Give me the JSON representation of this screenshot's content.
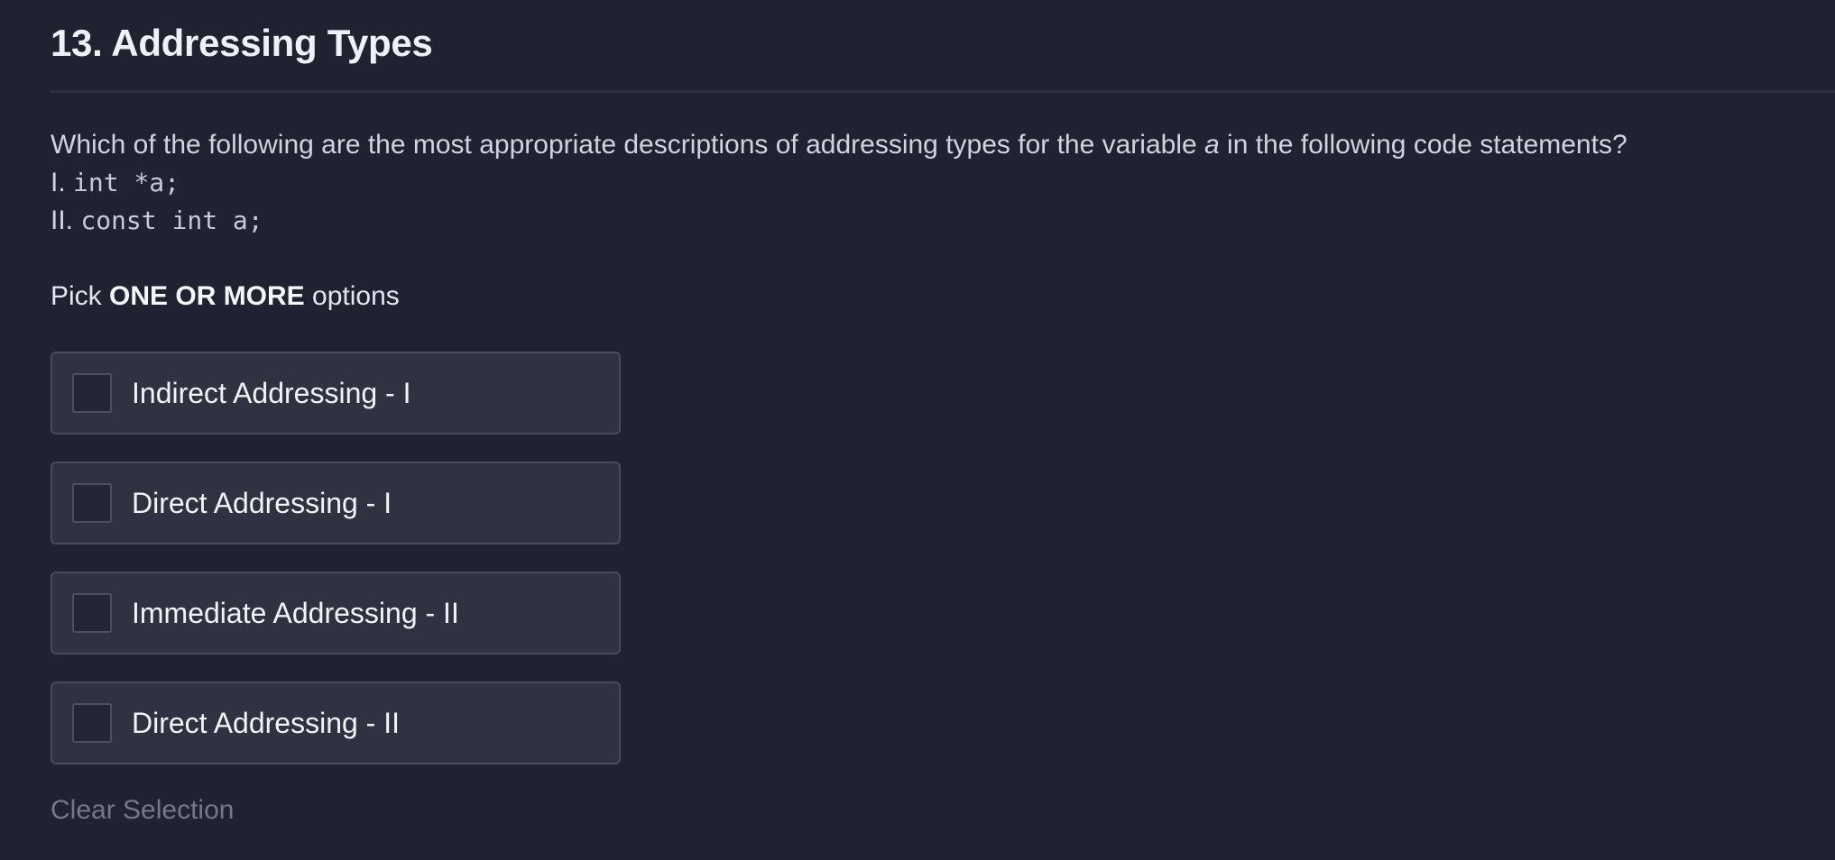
{
  "page": {
    "title": "13. Addressing Types"
  },
  "question": {
    "prompt_before_var": "Which of the following are the most appropriate descriptions of addressing types for the variable ",
    "variable": "a",
    "prompt_after_var": " in the following code statements?",
    "statements": [
      {
        "label": "I.",
        "code": "int *a;"
      },
      {
        "label": "II.",
        "code": "const int a;"
      }
    ]
  },
  "instruction": {
    "prefix": "Pick ",
    "emphasis": "ONE OR MORE",
    "suffix": " options"
  },
  "options": [
    {
      "label": "Indirect Addressing - I",
      "checked": false
    },
    {
      "label": "Direct Addressing - I",
      "checked": false
    },
    {
      "label": "Immediate Addressing - II",
      "checked": false
    },
    {
      "label": "Direct Addressing - II",
      "checked": false
    }
  ],
  "actions": {
    "clear_selection": "Clear Selection"
  },
  "colors": {
    "background": "#1f2331",
    "option_background": "#2f3341",
    "option_border": "#474c5b",
    "muted_link": "#747987"
  }
}
